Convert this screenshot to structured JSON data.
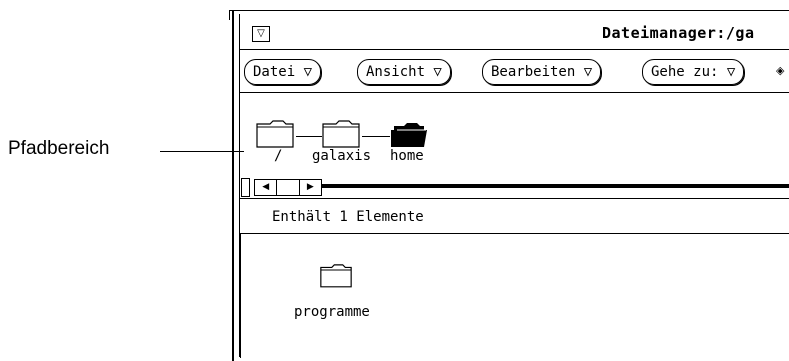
{
  "annotation": {
    "label": "Pfadbereich"
  },
  "window": {
    "title": "Dateimanager:/ga",
    "menu_glyph": "▽"
  },
  "menubar": {
    "datei": "Datei ▽",
    "ansicht": "Ansicht ▽",
    "bearbeiten": "Bearbeiten ▽",
    "gehe_zu": "Gehe zu: ▽"
  },
  "path": {
    "items": [
      {
        "label": "/",
        "icon": "folder-icon",
        "open": false
      },
      {
        "label": "galaxis",
        "icon": "folder-icon",
        "open": false
      },
      {
        "label": "home",
        "icon": "folder-open-icon",
        "open": true
      }
    ]
  },
  "scrollbar": {
    "left_arrow": "◀",
    "right_arrow": "▶"
  },
  "status": {
    "text": "Enthält 1 Elemente"
  },
  "files": [
    {
      "label": "programme",
      "icon": "folder-icon"
    }
  ]
}
